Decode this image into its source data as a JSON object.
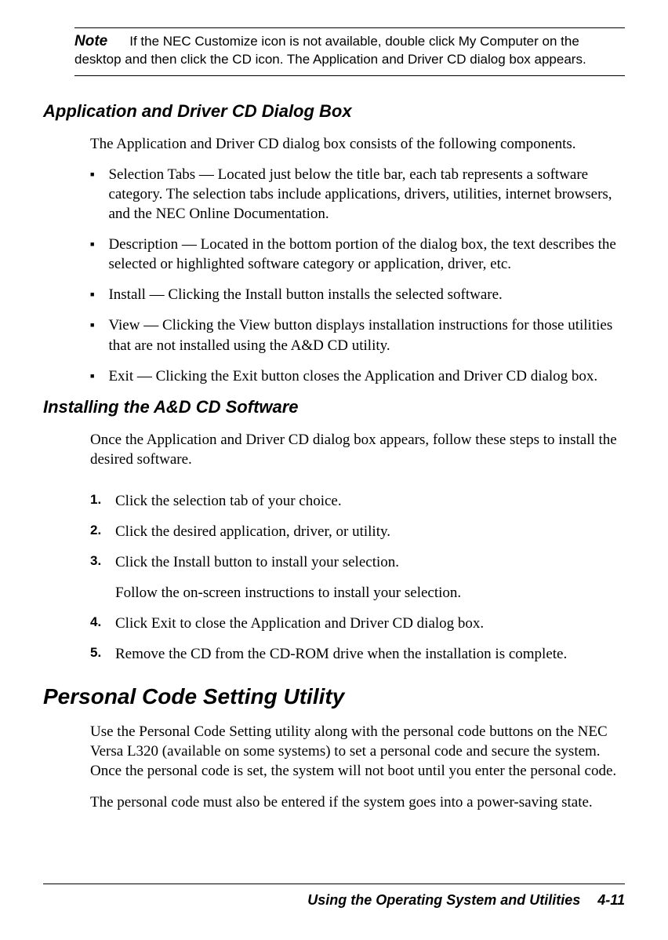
{
  "note": {
    "label": "Note",
    "text": "If the NEC Customize icon is not available, double click My Computer on the desktop and then click the CD icon. The Application and Driver CD dialog box appears."
  },
  "section1": {
    "heading": "Application and Driver CD Dialog Box",
    "intro": "The Application and Driver CD dialog box consists of the following components.",
    "bullets": [
      "Selection Tabs — Located just below the title bar, each tab represents a software category. The selection tabs include applications, drivers, utilities, internet browsers, and the NEC Online Documentation.",
      "Description — Located in the bottom portion of the dialog box, the text describes the selected or highlighted software category or application, driver, etc.",
      "Install — Clicking the Install button installs the selected software.",
      "View — Clicking the View button displays installation instructions for those utilities that are not installed using the A&D CD utility.",
      "Exit — Clicking the Exit button closes the Application and Driver CD dialog box."
    ]
  },
  "section2": {
    "heading": "Installing the A&D CD Software",
    "intro": "Once the Application and Driver CD dialog box appears, follow these steps to install the desired software.",
    "steps": [
      {
        "num": "1.",
        "text": "Click the selection tab of your choice."
      },
      {
        "num": "2.",
        "text": "Click the desired application, driver, or utility."
      },
      {
        "num": "3.",
        "text": "Click the Install button to install your selection.",
        "sub": "Follow the on-screen instructions to install your selection."
      },
      {
        "num": "4.",
        "text": "Click Exit to close the Application and Driver CD dialog box."
      },
      {
        "num": "5.",
        "text": "Remove the CD from the CD-ROM drive when the installation is complete."
      }
    ]
  },
  "section3": {
    "heading": "Personal Code Setting Utility",
    "para1": "Use the Personal Code Setting utility along with the personal code buttons on the NEC Versa L320 (available on some systems) to set a personal code and secure the system. Once the personal code is set, the system will not boot until you enter the personal code.",
    "para2": "The personal code must also be entered if the system goes into a power-saving state."
  },
  "footer": {
    "title": "Using the Operating System and Utilities",
    "page": "4-11"
  }
}
